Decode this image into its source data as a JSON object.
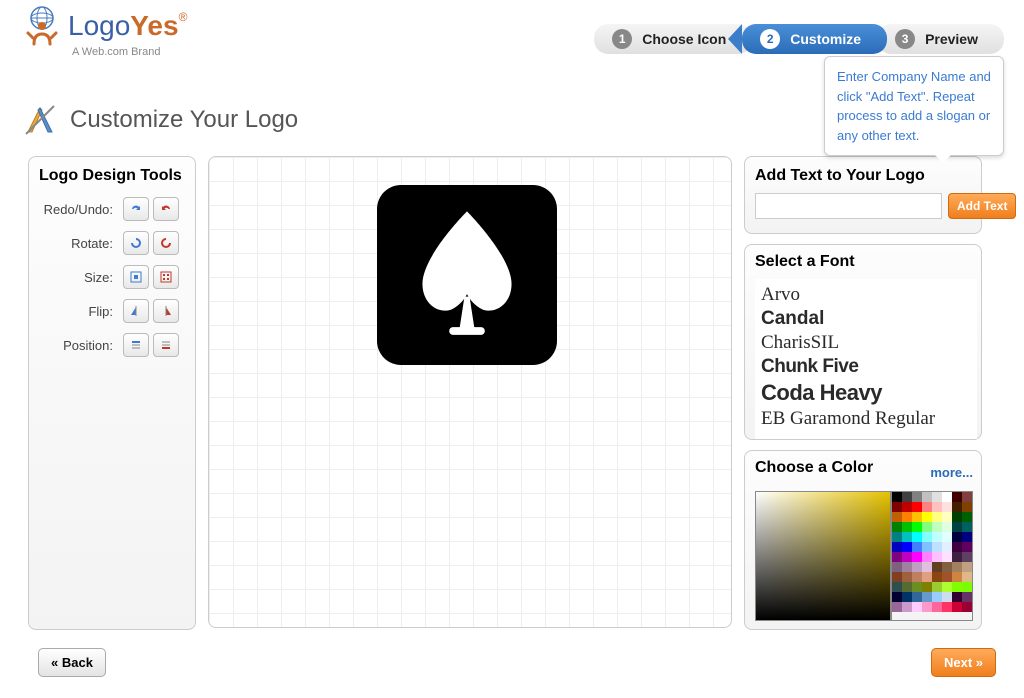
{
  "brand": {
    "name1": "Logo",
    "name2": "Yes",
    "reg": "®",
    "tagline": "A Web.com Brand"
  },
  "steps": [
    {
      "num": "1",
      "label": "Choose Icon"
    },
    {
      "num": "2",
      "label": "Customize"
    },
    {
      "num": "3",
      "label": "Preview"
    }
  ],
  "tooltip": "Enter Company Name and click \"Add Text\". Repeat process to add a slogan or any other text.",
  "page_title": "Customize Your Logo",
  "tools": {
    "heading": "Logo Design Tools",
    "rows": {
      "redo_undo": "Redo/Undo:",
      "rotate": "Rotate:",
      "size": "Size:",
      "flip": "Flip:",
      "position": "Position:"
    }
  },
  "add_text": {
    "heading": "Add Text to Your Logo",
    "button": "Add Text",
    "value": ""
  },
  "fonts": {
    "heading": "Select a Font",
    "list": [
      "Arvo",
      "Candal",
      "CharisSIL",
      "Chunk Five",
      "Coda Heavy",
      "EB Garamond Regular"
    ]
  },
  "color": {
    "heading": "Choose a Color",
    "more": "more..."
  },
  "swatches": [
    "#000000",
    "#404040",
    "#808080",
    "#c0c0c0",
    "#e0e0e0",
    "#ffffff",
    "#400000",
    "#804040",
    "#800000",
    "#c00000",
    "#ff0000",
    "#ff8080",
    "#ffc0c0",
    "#ffe0e0",
    "#402000",
    "#804000",
    "#c06000",
    "#ff8000",
    "#ffc000",
    "#ffff00",
    "#ffff80",
    "#ffffc0",
    "#004000",
    "#006000",
    "#008000",
    "#00c000",
    "#00ff00",
    "#80ff80",
    "#c0ffc0",
    "#e0ffe0",
    "#004040",
    "#006060",
    "#008080",
    "#00c0c0",
    "#00ffff",
    "#80ffff",
    "#c0ffff",
    "#e0ffff",
    "#000040",
    "#000080",
    "#0000c0",
    "#0000ff",
    "#4080ff",
    "#80c0ff",
    "#c0e0ff",
    "#e0f0ff",
    "#400040",
    "#600060",
    "#800080",
    "#c000c0",
    "#ff00ff",
    "#ff80ff",
    "#ffc0ff",
    "#ffe0ff",
    "#402040",
    "#604060",
    "#806080",
    "#a080a0",
    "#c0a0c0",
    "#e0c0e0",
    "#604020",
    "#806040",
    "#a08060",
    "#c0a080",
    "#804020",
    "#a06040",
    "#c08060",
    "#e0a080",
    "#8b4513",
    "#a0522d",
    "#cd853f",
    "#deb887",
    "#2f4f4f",
    "#556b2f",
    "#6b8e23",
    "#808000",
    "#9acd32",
    "#adff2f",
    "#7fff00",
    "#7cfc00",
    "#000033",
    "#003366",
    "#336699",
    "#6699cc",
    "#99ccff",
    "#ccddee",
    "#330033",
    "#663366",
    "#996699",
    "#cc99cc",
    "#ffccff",
    "#ff99cc",
    "#ff6699",
    "#ff3366",
    "#cc0033",
    "#990033"
  ],
  "nav": {
    "back": "« Back",
    "next": "Next »"
  }
}
